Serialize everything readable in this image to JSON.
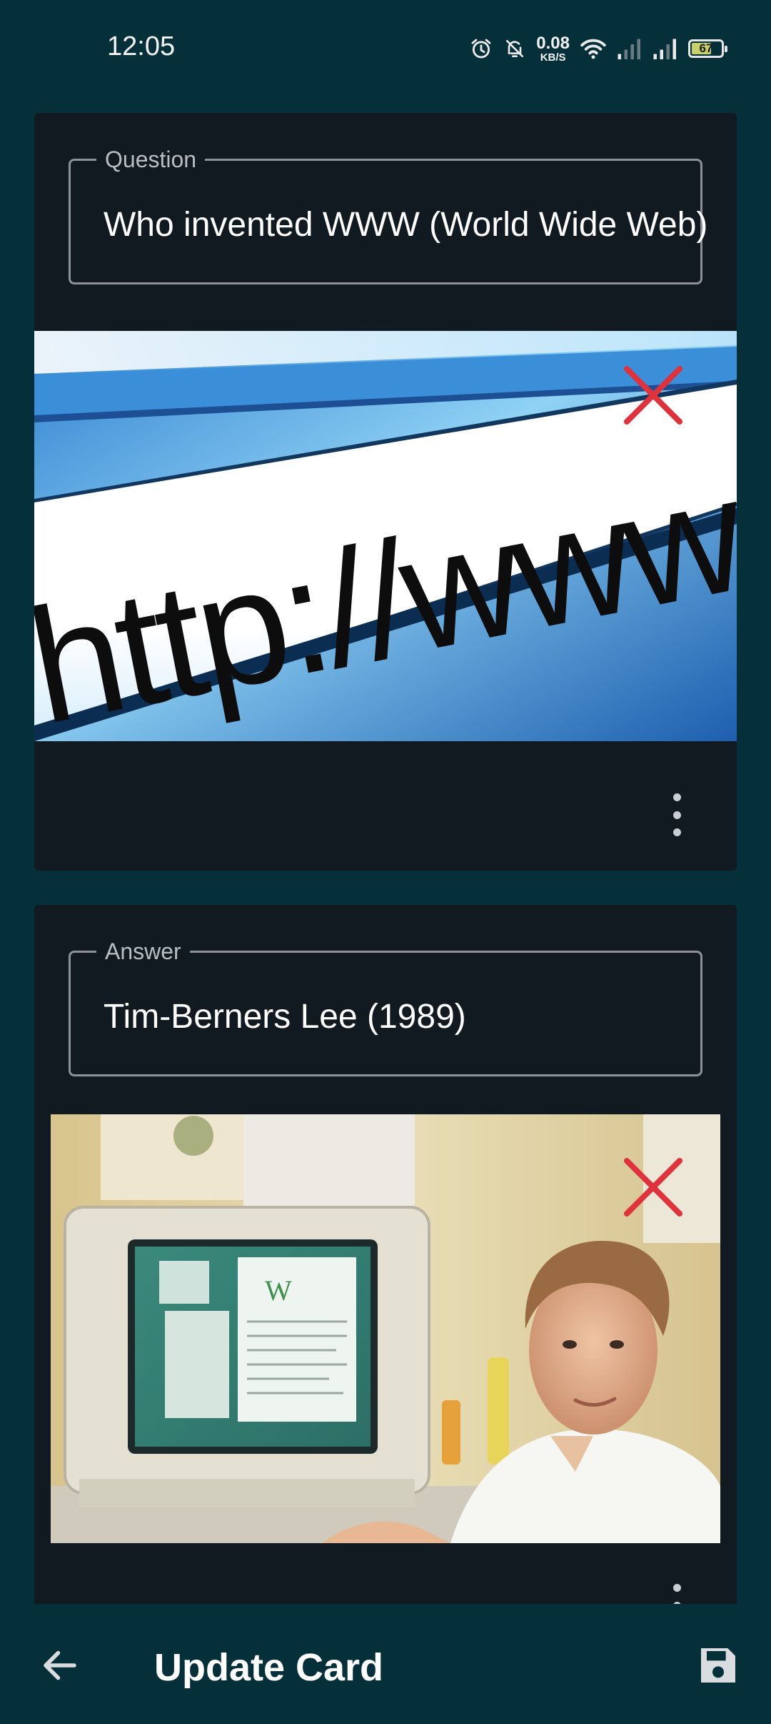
{
  "status_bar": {
    "time": "12:05",
    "net_speed_value": "0.08",
    "net_speed_unit": "KB/S",
    "battery_level": "67",
    "icons": [
      "alarm-icon",
      "mute-bell-icon",
      "wifi-icon",
      "signal-icon",
      "signal-icon",
      "battery-icon"
    ]
  },
  "question_card": {
    "label": "Question",
    "value": "Who invented WWW (World Wide Web)",
    "image_text": "http://www",
    "remove_icon": "close-icon",
    "menu_icon": "more-vert-icon"
  },
  "answer_card": {
    "label": "Answer",
    "value": "Tim-Berners Lee (1989)",
    "remove_icon": "close-icon",
    "menu_icon": "more-vert-icon"
  },
  "bottom_bar": {
    "title": "Update Card",
    "back_icon": "arrow-back-icon",
    "save_icon": "save-icon"
  },
  "colors": {
    "background": "#05303a",
    "card": "#111a21",
    "remove_x": "#e0323c"
  }
}
